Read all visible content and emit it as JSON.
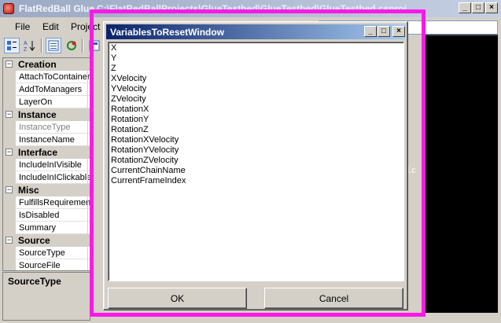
{
  "main_window": {
    "title": "FlatRedBall Glue",
    "path_fragment": "C:\\FlatRedBallProjects\\GlueTestbed\\GlueTestbed\\GlueTestbed.csproj"
  },
  "menu": [
    "File",
    "Edit",
    "Project"
  ],
  "toolbar": {
    "buttons": [
      "categorized-icon",
      "sort-alpha-icon",
      "property-pages-icon",
      "refresh-icon",
      "events-icon"
    ]
  },
  "property_grid": {
    "rows": [
      {
        "kind": "category",
        "label": "Creation"
      },
      {
        "kind": "prop",
        "label": "AttachToContainer"
      },
      {
        "kind": "prop",
        "label": "AddToManagers"
      },
      {
        "kind": "prop",
        "label": "LayerOn"
      },
      {
        "kind": "category",
        "label": "Instance"
      },
      {
        "kind": "prop",
        "label": "InstanceType",
        "disabled": true
      },
      {
        "kind": "prop",
        "label": "InstanceName"
      },
      {
        "kind": "category",
        "label": "Interface"
      },
      {
        "kind": "prop",
        "label": "IncludeInIVisible"
      },
      {
        "kind": "prop",
        "label": "IncludeInIClickable"
      },
      {
        "kind": "category",
        "label": "Misc"
      },
      {
        "kind": "prop",
        "label": "FulfillsRequirement"
      },
      {
        "kind": "prop",
        "label": "IsDisabled"
      },
      {
        "kind": "prop",
        "label": "Summary"
      },
      {
        "kind": "category",
        "label": "Source"
      },
      {
        "kind": "prop",
        "label": "SourceType"
      },
      {
        "kind": "prop",
        "label": "SourceFile"
      }
    ],
    "description_title": "SourceType"
  },
  "background_fragment": "d.c",
  "dialog": {
    "title": "VariablesToResetWindow",
    "items": [
      "X",
      "Y",
      "Z",
      "XVelocity",
      "YVelocity",
      "ZVelocity",
      "RotationX",
      "RotationY",
      "RotationZ",
      "RotationXVelocity",
      "RotationYVelocity",
      "RotationZVelocity",
      "CurrentChainName",
      "CurrentFrameIndex"
    ],
    "ok_label": "OK",
    "cancel_label": "Cancel"
  },
  "colors": {
    "highlight": "#ff19e6",
    "dialog_title_start": "#0a246a",
    "dialog_title_end": "#a6caf0"
  }
}
